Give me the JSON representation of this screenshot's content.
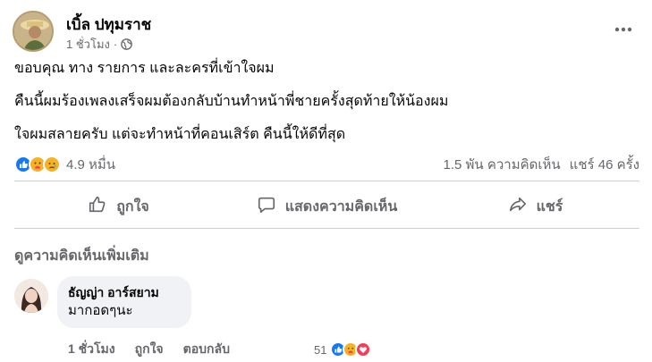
{
  "post": {
    "author": "เบิ้ล ปทุมราช",
    "time": "1 ชั่วโมง",
    "separator": "·",
    "audience_icon": "globe-icon",
    "more_icon": "more-dots-icon",
    "lines": [
      "ขอบคุณ ทาง รายการ และละครที่เข้าใจผม",
      "คืนนี้ผมร้องเพลงเสร็จผมต้องกลับบ้านทำหน้าพี่ชายครั้งสุดท้ายให้น้องผม",
      "ใจผมสลายครับ แต่จะทำหน้าที่คอนเสิร์ต คืนนี้ให้ดีที่สุด"
    ]
  },
  "stats": {
    "reaction_icons": [
      "like-icon",
      "care-icon",
      "sad-icon"
    ],
    "reactions_count": "4.9 หมื่น",
    "comments": "1.5 พัน ความคิดเห็น",
    "shares": "แชร์ 46 ครั้ง"
  },
  "actions": {
    "like": "ถูกใจ",
    "comment": "แสดงความคิดเห็น",
    "share": "แชร์"
  },
  "comments_section": {
    "more_label": "ดูความคิดเห็นเพิ่มเติม",
    "comment": {
      "author": "ธัญญ่า อาร์สยาม",
      "text": "มากอดๆนะ",
      "time": "1 ชั่วโมง",
      "like_label": "ถูกใจ",
      "reply_label": "ตอบกลับ",
      "reactions_count": "51",
      "reaction_icons": [
        "like-icon",
        "care-icon",
        "love-icon"
      ]
    }
  },
  "colors": {
    "like_blue": "#1877f2",
    "care_yellow": "#f7b125",
    "love_red": "#f33e58",
    "secondary_text": "#65676b"
  }
}
